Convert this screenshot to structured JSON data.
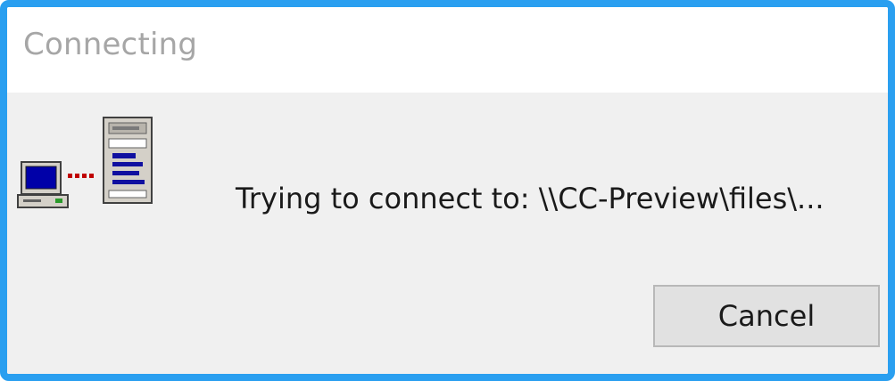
{
  "dialog": {
    "title": "Connecting",
    "message": "Trying to connect to: \\\\CC-Preview\\files\\...",
    "icon": "computer-to-server-connecting-icon",
    "cancel_label": "Cancel"
  },
  "colors": {
    "frame_border": "#2a9ff0",
    "title_text": "#a6a6a6",
    "dialog_background": "#f0f0f0",
    "button_background": "#e1e1e1"
  }
}
